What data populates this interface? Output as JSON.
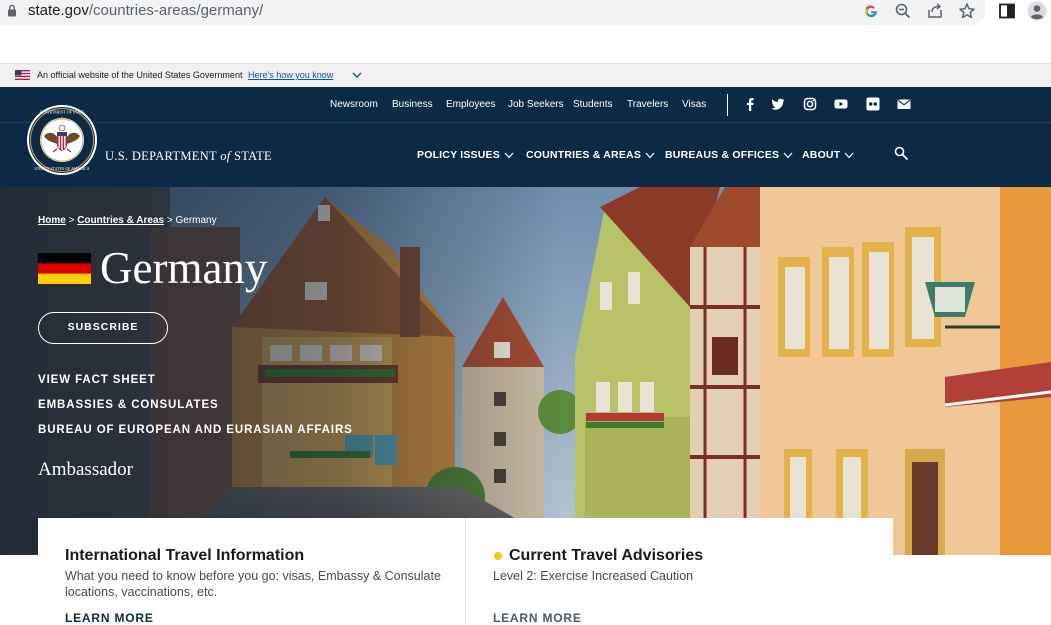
{
  "browser": {
    "url_domain": "state.gov",
    "url_path": "/countries-areas/germany/"
  },
  "gov_banner": {
    "text": "An official website of the United States Government",
    "link": "Here's how you know"
  },
  "utility_nav": [
    "Newsroom",
    "Business",
    "Employees",
    "Job Seekers",
    "Students",
    "Travelers",
    "Visas"
  ],
  "social_icons": [
    "facebook-icon",
    "twitter-icon",
    "instagram-icon",
    "youtube-icon",
    "flickr-icon",
    "email-icon"
  ],
  "header": {
    "dept_prefix": "U.S. DEPARTMENT",
    "dept_of": "of",
    "dept_suffix": "STATE"
  },
  "main_nav": [
    "POLICY ISSUES",
    "COUNTRIES & AREAS",
    "BUREAUS & OFFICES",
    "ABOUT"
  ],
  "breadcrumb": {
    "home": "Home",
    "sep1": ">",
    "countries": "Countries & Areas",
    "sep2": ">",
    "current": "Germany"
  },
  "hero": {
    "title": "Germany",
    "subscribe": "SUBSCRIBE",
    "links": [
      "VIEW FACT SHEET",
      "EMBASSIES & CONSULATES",
      "BUREAU OF EUROPEAN AND EURASIAN AFFAIRS"
    ],
    "ambassador": "Ambassador"
  },
  "cards": [
    {
      "title": "International Travel Information",
      "desc": "What you need to know before you go: visas, Embassy & Consulate locations, vaccinations, etc.",
      "link": "LEARN MORE"
    },
    {
      "title": "Current Travel Advisories",
      "desc": "Level 2: Exercise Increased Caution",
      "link": "LEARN MORE"
    }
  ],
  "colors": {
    "header_navy": "#0c2a46",
    "advisory_yellow": "#f2c80f",
    "flag_black": "#000000",
    "flag_red": "#dd0000",
    "flag_gold": "#ffce00"
  }
}
